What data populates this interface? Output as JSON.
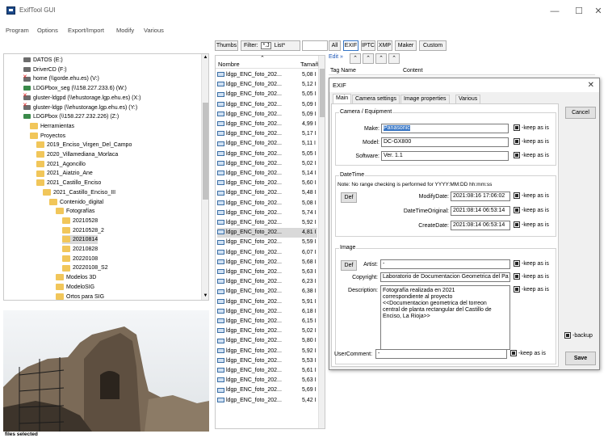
{
  "window": {
    "title": "ExifTool GUI",
    "buttons": {
      "minimize": "—",
      "maximize": "☐",
      "close": "✕"
    }
  },
  "menu": [
    "Program",
    "Options",
    "Export/Import",
    "Modify",
    "Various"
  ],
  "tree": [
    {
      "label": "DATOS (E:)",
      "icon": "drive"
    },
    {
      "label": "DriverCD (F:)",
      "icon": "drive"
    },
    {
      "label": "home (\\\\gorde.ehu.es) (V:)",
      "icon": "xdrive"
    },
    {
      "label": "LDGPbox_seg (\\\\158.227.233.6) (W:)",
      "icon": "ndrive"
    },
    {
      "label": "gluster-ldgpd (\\\\ehustorage.lgp.ehu.es) (X:)",
      "icon": "xdrive"
    },
    {
      "label": "gluster-ldgp (\\\\ehustorage.lgp.ehu.es) (Y:)",
      "icon": "xdrive"
    },
    {
      "label": "LDGPbox (\\\\158.227.232.226) (Z:)",
      "icon": "ndrive"
    },
    {
      "label": "Herramientas",
      "icon": "folder"
    },
    {
      "label": "Proyectos",
      "icon": "folder"
    },
    {
      "label": "2019_Enciso_Virgen_Del_Campo",
      "icon": "folder"
    },
    {
      "label": "2020_Villamediana_Morlaca",
      "icon": "folder"
    },
    {
      "label": "2021_Agoncillo",
      "icon": "folder"
    },
    {
      "label": "2021_Aiatzio_Ane",
      "icon": "folder"
    },
    {
      "label": "2021_Castillo_Enciso",
      "icon": "folder"
    },
    {
      "label": "2021_Castillo_Enciso_III",
      "icon": "folder"
    },
    {
      "label": "Contenido_digital",
      "icon": "folder"
    },
    {
      "label": "Fotografías",
      "icon": "folder"
    },
    {
      "label": "20210528",
      "icon": "folder"
    },
    {
      "label": "20210528_2",
      "icon": "folder"
    },
    {
      "label": "20210814",
      "icon": "folder",
      "selected": true
    },
    {
      "label": "20210828",
      "icon": "folder"
    },
    {
      "label": "20220108",
      "icon": "folder"
    },
    {
      "label": "20220108_S2",
      "icon": "folder"
    },
    {
      "label": "Modelos 3D",
      "icon": "folder"
    },
    {
      "label": "ModeloSIG",
      "icon": "folder"
    },
    {
      "label": "Ortos para SIG",
      "icon": "folder"
    }
  ],
  "filelist": {
    "buttons": {
      "thumbs": "Thumbs",
      "filter_label": "Filter:",
      "filter_value": "*.J",
      "list": "List*"
    },
    "columns": {
      "name": "Nombre",
      "size": "Tamaño"
    },
    "rows": [
      {
        "name": "ldgp_ENC_foto_202...",
        "size": "5,08 I"
      },
      {
        "name": "ldgp_ENC_foto_202...",
        "size": "5,12 I"
      },
      {
        "name": "ldgp_ENC_foto_202...",
        "size": "5,05 I"
      },
      {
        "name": "ldgp_ENC_foto_202...",
        "size": "5,09 I"
      },
      {
        "name": "ldgp_ENC_foto_202...",
        "size": "5,09 I"
      },
      {
        "name": "ldgp_ENC_foto_202...",
        "size": "4,99 I"
      },
      {
        "name": "ldgp_ENC_foto_202...",
        "size": "5,17 I"
      },
      {
        "name": "ldgp_ENC_foto_202...",
        "size": "5,11 I"
      },
      {
        "name": "ldgp_ENC_foto_202...",
        "size": "5,05 I"
      },
      {
        "name": "ldgp_ENC_foto_202...",
        "size": "5,02 I"
      },
      {
        "name": "ldgp_ENC_foto_202...",
        "size": "5,14 I"
      },
      {
        "name": "ldgp_ENC_foto_202...",
        "size": "5,60 I"
      },
      {
        "name": "ldgp_ENC_foto_202...",
        "size": "5,48 I"
      },
      {
        "name": "ldgp_ENC_foto_202...",
        "size": "5,08 I"
      },
      {
        "name": "ldgp_ENC_foto_202...",
        "size": "5,74 I"
      },
      {
        "name": "ldgp_ENC_foto_202...",
        "size": "5,92 I"
      },
      {
        "name": "ldgp_ENC_foto_202...",
        "size": "4,81 I",
        "selected": true
      },
      {
        "name": "ldgp_ENC_foto_202...",
        "size": "5,59 I"
      },
      {
        "name": "ldgp_ENC_foto_202...",
        "size": "6,07 I"
      },
      {
        "name": "ldgp_ENC_foto_202...",
        "size": "5,68 I"
      },
      {
        "name": "ldgp_ENC_foto_202...",
        "size": "5,63 I"
      },
      {
        "name": "ldgp_ENC_foto_202...",
        "size": "6,23 I"
      },
      {
        "name": "ldgp_ENC_foto_202...",
        "size": "6,38 I"
      },
      {
        "name": "ldgp_ENC_foto_202...",
        "size": "5,91 I"
      },
      {
        "name": "ldgp_ENC_foto_202...",
        "size": "6,18 I"
      },
      {
        "name": "ldgp_ENC_foto_202...",
        "size": "6,15 I"
      },
      {
        "name": "ldgp_ENC_foto_202...",
        "size": "5,02 I"
      },
      {
        "name": "ldgp_ENC_foto_202...",
        "size": "5,80 I"
      },
      {
        "name": "ldgp_ENC_foto_202...",
        "size": "5,92 I"
      },
      {
        "name": "ldgp_ENC_foto_202...",
        "size": "5,53 I"
      },
      {
        "name": "ldgp_ENC_foto_202...",
        "size": "5,61 I"
      },
      {
        "name": "ldgp_ENC_foto_202...",
        "size": "5,63 I"
      },
      {
        "name": "ldgp_ENC_foto_202...",
        "size": "5,69 I"
      },
      {
        "name": "ldgp_ENC_foto_202...",
        "size": "5,42 I"
      }
    ]
  },
  "right": {
    "tabs": [
      "All",
      "EXIF",
      "IPTC",
      "XMP",
      "Maker",
      "Custom"
    ],
    "edit": "Edit »",
    "columns": {
      "tag": "Tag Name",
      "content": "Content"
    }
  },
  "dialog": {
    "title": "EXIF",
    "close": "✕",
    "tabs": [
      "Main",
      "Camera settings",
      "Image properties",
      "Various"
    ],
    "camera": {
      "group": "Camera / Equipment",
      "make_label": "Make:",
      "make": "Panasonic",
      "model_label": "Model:",
      "model": "DC-GX800",
      "software_label": "Software:",
      "software": "Ver. 1.1"
    },
    "datetime": {
      "group": "DateTime",
      "note": "Note: No range checking is performed for YYYY:MM:DD hh:mm:ss",
      "def": "Def",
      "modify_label": "ModifyDate:",
      "modify": "2021:08:16 17:06:02",
      "original_label": "DateTimeOriginal:",
      "original": "2021:08:14 06:53:14",
      "create_label": "CreateDate:",
      "create": "2021:08:14 06:53:14"
    },
    "image": {
      "group": "Image",
      "def": "Def",
      "artist_label": "Artist:",
      "artist": "-",
      "copyright_label": "Copyright:",
      "copyright": "Laboratorio de Documentacion Geometrica del Pa",
      "description_label": "Description:",
      "description": "Fotografía realizada en 2021\ncorrespondiente al proyecto\n<<Documentacion geometrica del torreon\ncentral de planta rectangular del Castillo de\nEnciso, La Rioja>>",
      "usercomment_label": "UserComment:",
      "usercomment": "-"
    },
    "keep": "-keep as is",
    "cancel": "Cancel",
    "backup": "-backup",
    "save": "Save"
  },
  "status": "files selected"
}
